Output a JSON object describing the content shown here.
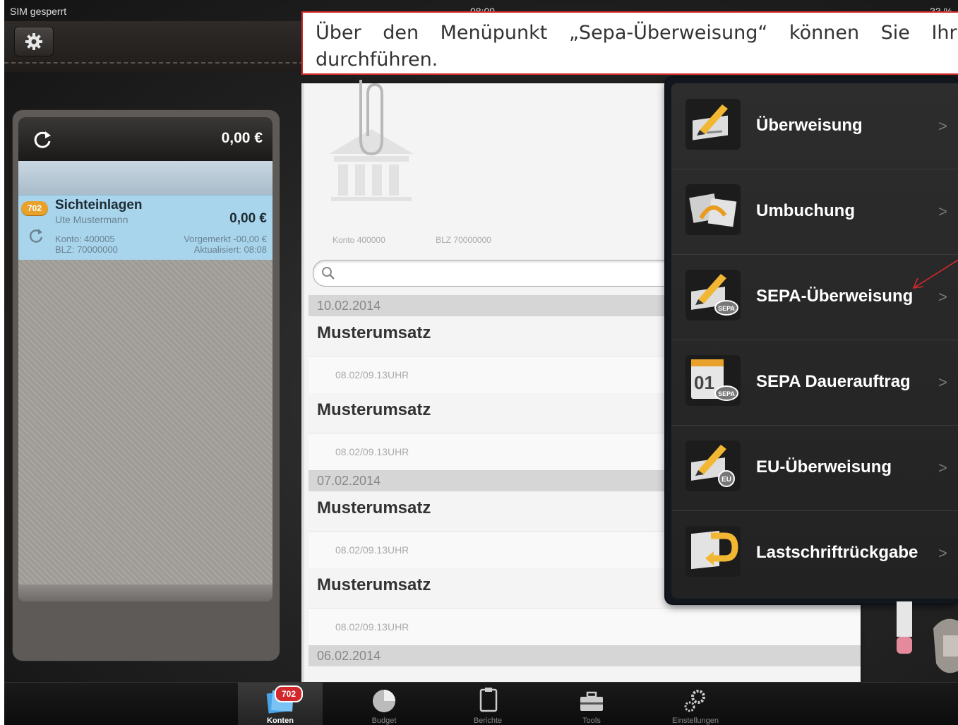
{
  "status_bar": {
    "carrier": "SIM gesperrt",
    "time": "08:09",
    "battery": "33 %"
  },
  "callout": {
    "line1": "Über den Menüpunkt „Sepa-Überweisung“ können Sie Ihr",
    "line2": "durchführen."
  },
  "account_panel": {
    "total": "0,00 €",
    "account": {
      "badge": "702",
      "name": "Sichteinlagen",
      "owner": "Ute Mustermann",
      "amount": "0,00 €",
      "konto": "Konto: 400005",
      "blz": "BLZ: 70000000",
      "vorgemerkt": "Vorgemerkt -00,00 €",
      "aktualisiert": "Aktualisiert: 08:08"
    }
  },
  "document": {
    "konto": "Konto 400000",
    "blz": "BLZ 70000000",
    "search_placeholder": ""
  },
  "transactions": {
    "groups": [
      {
        "date": "10.02.2014",
        "items": [
          {
            "title": "Musterumsatz",
            "sub": "08.02/09.13UHR"
          },
          {
            "title": "Musterumsatz",
            "sub": "08.02/09.13UHR"
          }
        ]
      },
      {
        "date": "07.02.2014",
        "items": [
          {
            "title": "Musterumsatz",
            "sub": "08.02/09.13UHR"
          },
          {
            "title": "Musterumsatz",
            "sub": "08.02/09.13UHR"
          }
        ]
      },
      {
        "date": "06.02.2014",
        "items": []
      }
    ]
  },
  "menu": {
    "items": [
      {
        "label": "Überweisung",
        "icon": "transfer-pen-icon"
      },
      {
        "label": "Umbuchung",
        "icon": "rebooking-icon"
      },
      {
        "label": "SEPA-Überweisung",
        "icon": "sepa-transfer-icon"
      },
      {
        "label": "SEPA Dauerauftrag",
        "icon": "sepa-standing-order-icon"
      },
      {
        "label": "EU-Überweisung",
        "icon": "eu-transfer-icon"
      },
      {
        "label": "Lastschriftrückgabe",
        "icon": "direct-debit-return-icon"
      }
    ],
    "chevron": ">"
  },
  "tabbar": {
    "badge": "702",
    "tabs": [
      {
        "label": "Konten",
        "icon": "accounts-icon",
        "active": true
      },
      {
        "label": "Budget",
        "icon": "budget-pie-icon",
        "active": false
      },
      {
        "label": "Berichte",
        "icon": "reports-icon",
        "active": false
      },
      {
        "label": "Tools",
        "icon": "toolbox-icon",
        "active": false
      },
      {
        "label": "Einstellungen",
        "icon": "settings-gears-icon",
        "active": false
      }
    ]
  },
  "colors": {
    "callout_border": "#d32a2a",
    "account_highlight": "#a8d5ec",
    "badge_orange": "#e8a22c",
    "tab_badge_red": "#d2272b"
  }
}
